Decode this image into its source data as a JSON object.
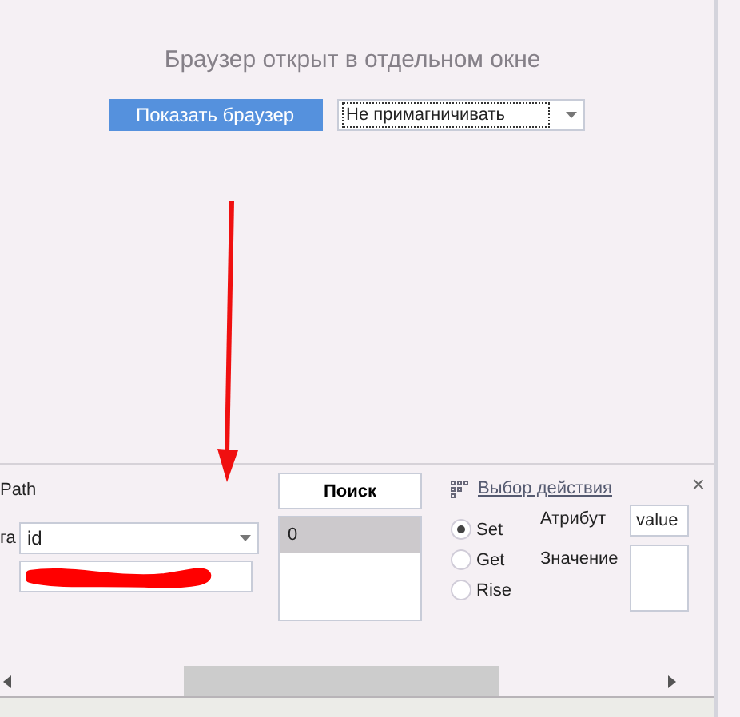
{
  "browser_notice": {
    "title": "Браузер открыт в отдельном окне",
    "show_button": "Показать браузер",
    "dock_select": {
      "value": "Не примагничивать"
    }
  },
  "search_panel": {
    "xpath_label": "Path",
    "tag_label": "га",
    "tag_select": {
      "value": "id"
    },
    "search_button": "Поиск",
    "results": [
      {
        "text": "0",
        "selected": true
      }
    ],
    "action_link": "Выбор действия",
    "close": "×",
    "modes": [
      {
        "label": "Set",
        "selected": true
      },
      {
        "label": "Get",
        "selected": false
      },
      {
        "label": "Rise",
        "selected": false
      }
    ],
    "attribute_label": "Атрибут",
    "attribute_value": "value",
    "value_label": "Значение"
  }
}
